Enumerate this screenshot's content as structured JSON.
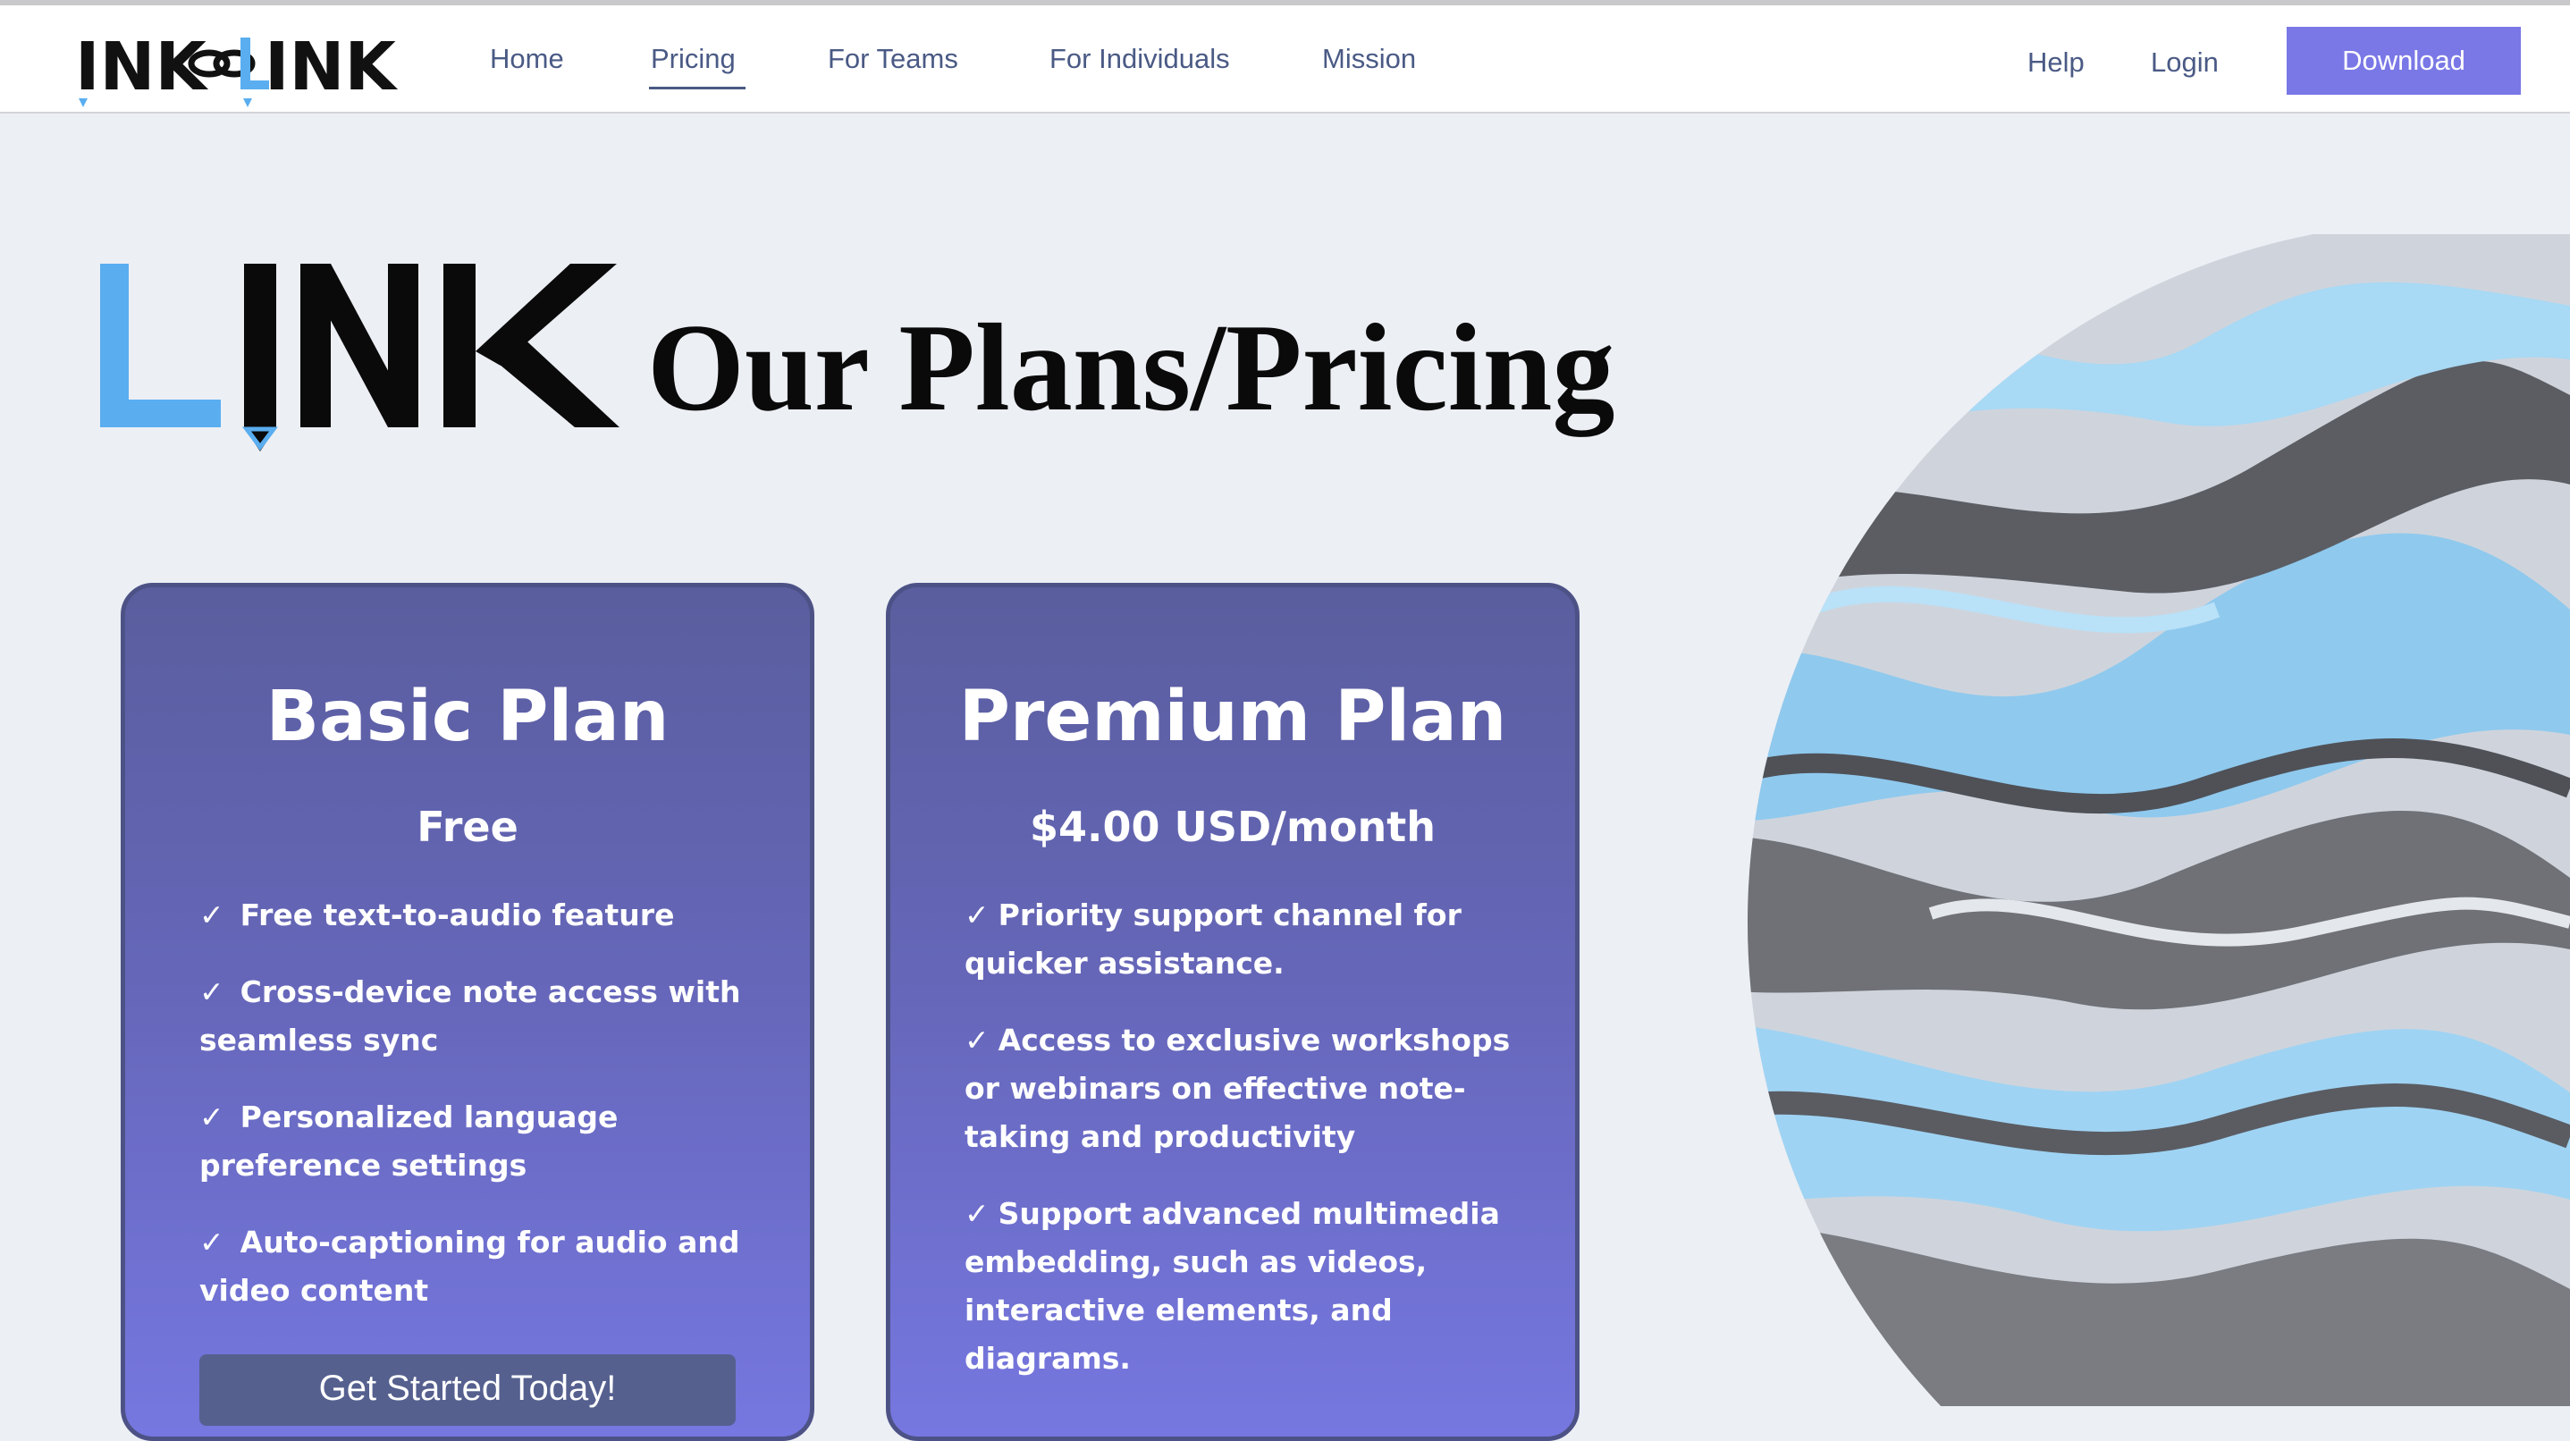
{
  "nav": {
    "logo_text": "INK–LINK",
    "links": [
      "Home",
      "Pricing",
      "For Teams",
      "For Individuals",
      "Mission"
    ],
    "help": "Help",
    "login": "Login",
    "download": "Download",
    "active": "Pricing"
  },
  "hero": {
    "logo_text": "LINK",
    "title": "Our Plans/Pricing"
  },
  "plans": [
    {
      "name": "Basic Plan",
      "price": "Free",
      "features": [
        "Free text-to-audio feature",
        "Cross-device note access with seamless sync",
        "Personalized language preference settings",
        "Auto-captioning for audio and video content"
      ],
      "cta": "Get Started Today!"
    },
    {
      "name": "Premium Plan",
      "price": "$4.00 USD/month",
      "features": [
        "Priority support channel for quicker assistance.",
        "Access to exclusive workshops or webinars on effective note-taking and productivity",
        "Support advanced multimedia embedding, such as videos, interactive elements, and diagrams."
      ]
    }
  ],
  "colors": {
    "accent": "#7a78e6",
    "nav_text": "#4a5a85",
    "card_top": "#5a5e9e",
    "card_bottom": "#7677e0",
    "logo_blue": "#5aaef0"
  }
}
